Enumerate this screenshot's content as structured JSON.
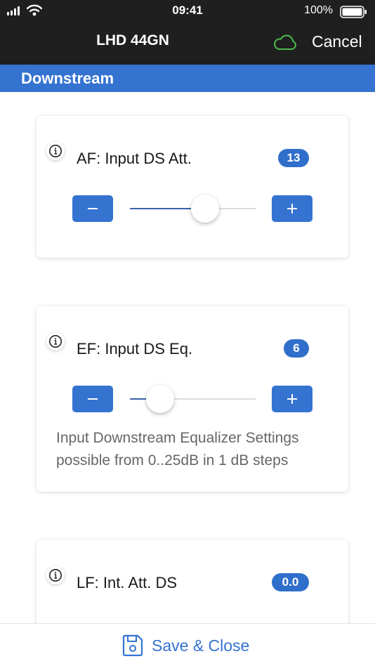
{
  "status_bar": {
    "time": "09:41",
    "battery": "100%"
  },
  "nav": {
    "title": "LHD 44GN",
    "cancel_label": "Cancel"
  },
  "section": {
    "title": "Downstream"
  },
  "cards": [
    {
      "label": "AF: Input DS Att.",
      "value": "13",
      "level": 0.6
    },
    {
      "label": "EF: Input DS Eq.",
      "value": "6",
      "level": 0.24,
      "description": "Input Downstream Equalizer Settings possible from 0..25dB in 1 dB steps"
    },
    {
      "label": "LF: Int. Att. DS",
      "value": "0.0"
    }
  ],
  "footer": {
    "save_label": "Save & Close"
  },
  "colors": {
    "accent": "#3573d1",
    "cloud": "#4cbb4c",
    "topbar": "#1f1f1f"
  }
}
